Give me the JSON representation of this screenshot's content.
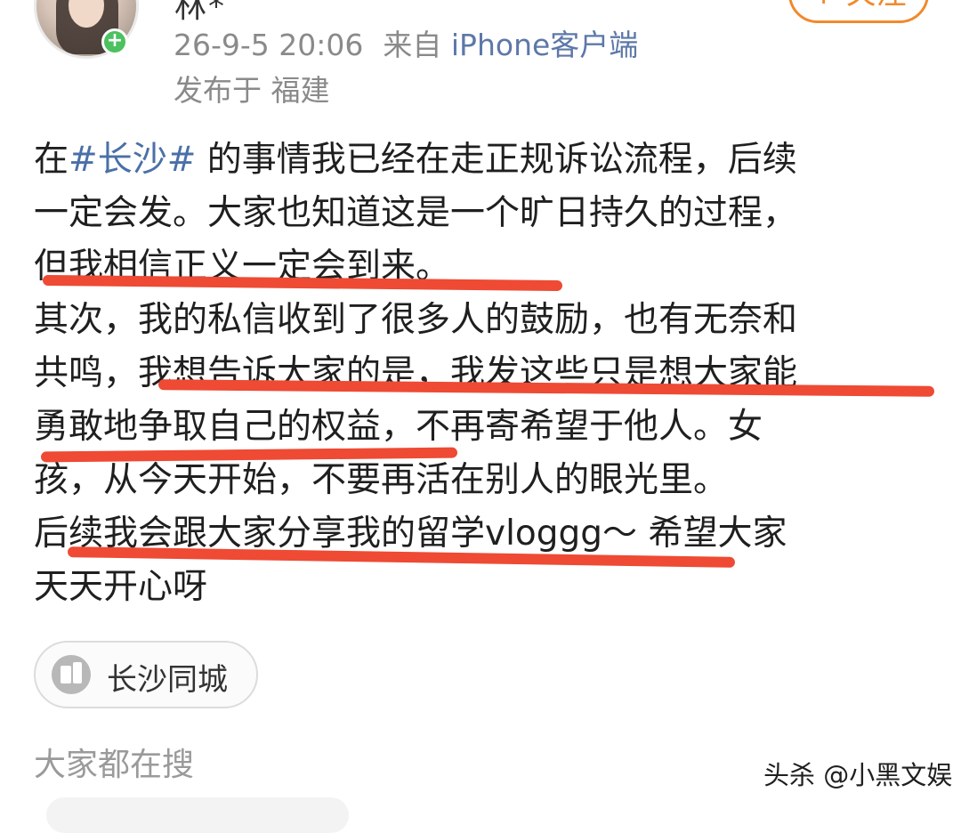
{
  "post_header": {
    "username": "林*",
    "date_time": "26-9-5 20:06",
    "source_prefix": "来自",
    "source_client": "iPhone客户端",
    "location": "发布于 福建",
    "follow_label": "+ 关注",
    "avatar_badge": "+"
  },
  "post": {
    "lines": [
      {
        "pre": "在",
        "hashtag": "#长沙#",
        "post": " 的事情我已经在走正规诉讼流程，后续"
      },
      {
        "text": "一定会发。大家也知道这是一个旷日持久的过程，"
      },
      {
        "text": "但我相信正义一定会到来。"
      },
      {
        "text": "其次，我的私信收到了很多人的鼓励，也有无奈和"
      },
      {
        "text": "共鸣，我想告诉大家的是，我发这些只是想大家能"
      },
      {
        "text": "勇敢地争取自己的权益，不再寄希望于他人。女"
      },
      {
        "text": "孩，从今天开始，不要再活在别人的眼光里。"
      },
      {
        "text": "后续我会跟大家分享我的留学vloggg～ 希望大家"
      },
      {
        "text": "天天开心呀"
      }
    ]
  },
  "topic_chip": {
    "label": "长沙同城",
    "icon": "building-icon"
  },
  "search_section": {
    "heading": "大家都在搜"
  },
  "watermark": {
    "text": "头杀 @小黑文娱"
  },
  "colors": {
    "hashtag": "#4a70a8",
    "underline": "#ee4a34",
    "follow_accent": "#f08a2c",
    "meta_gray": "#8a8a8a"
  }
}
